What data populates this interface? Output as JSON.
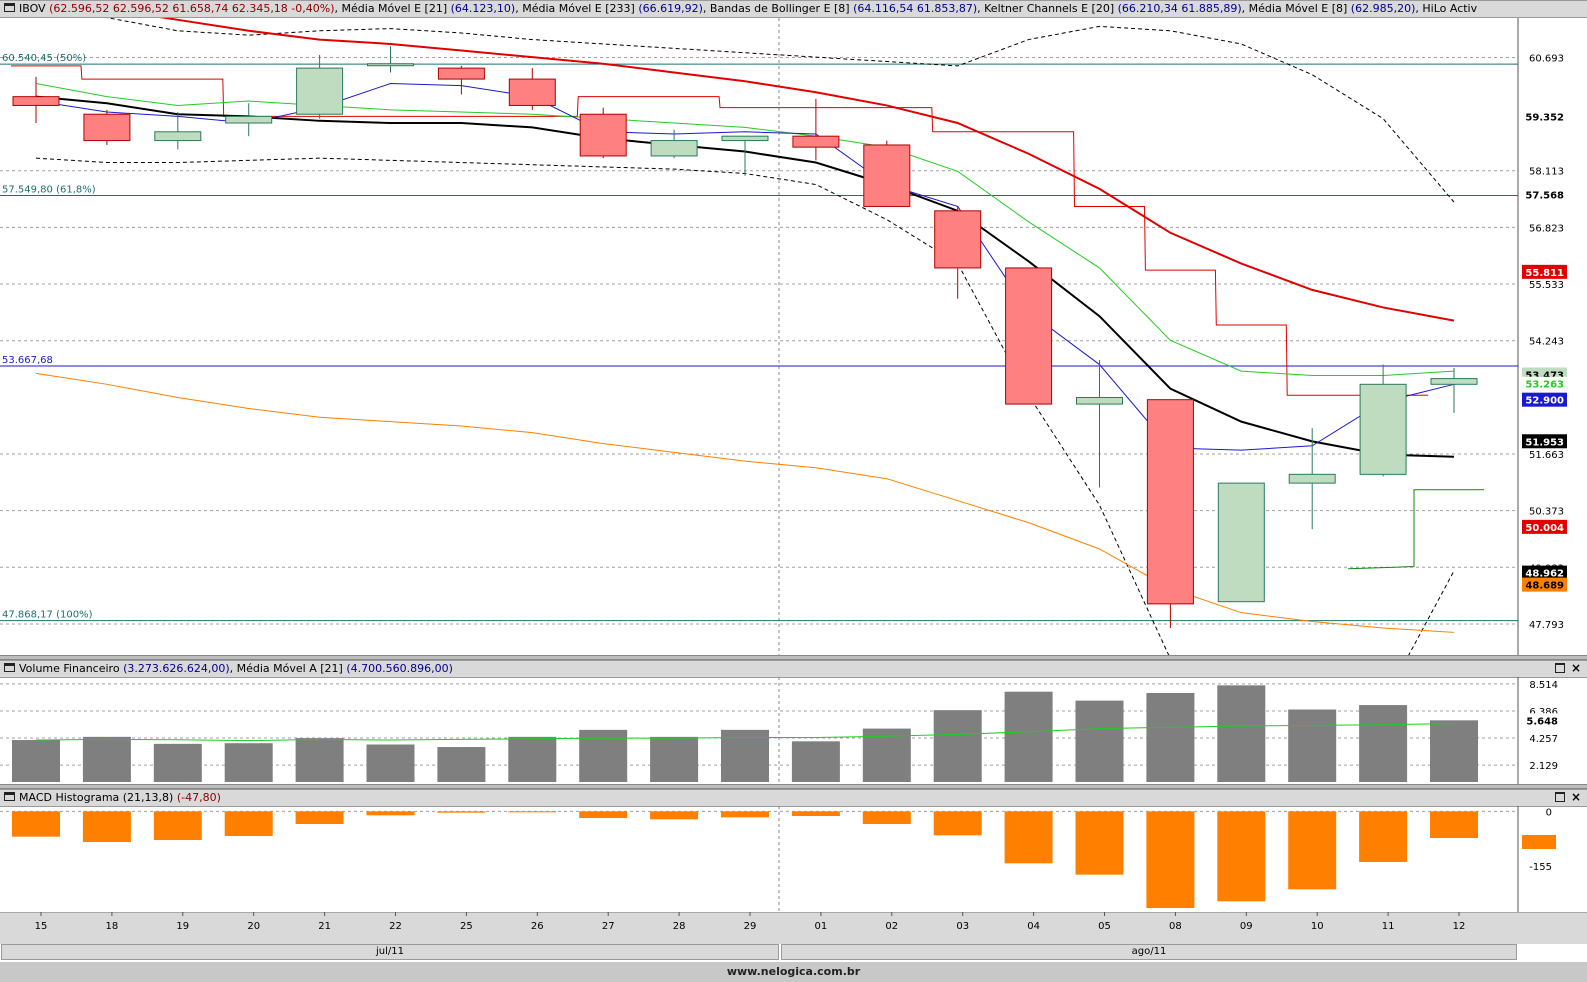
{
  "main_header": {
    "symbol": "IBOV",
    "ohlc": "(62.596,52  62.596,52  61.658,74  62.345,18  -0,40%)",
    "ema21_label": "Média Móvel E [21]",
    "ema21_val": "(64.123,10)",
    "ema233_label": "Média Móvel E [233]",
    "ema233_val": "(66.619,92)",
    "boll_label": "Bandas de Bollinger E [8]",
    "boll_val": "(64.116,54  61.853,87)",
    "kelt_label": "Keltner Channels E [20]",
    "kelt_val": "(66.210,34  61.885,89)",
    "ema8_label": "Média Móvel E [8]",
    "ema8_val": "(62.985,20)",
    "hilo_label": "HiLo Activ"
  },
  "vol_header": {
    "label": "Volume Financeiro",
    "val": "(3.273.626.624,00)",
    "ma_label": "Média Móvel A [21]",
    "ma_val": "(4.700.560.896,00)"
  },
  "macd_header": {
    "label": "MACD Histograma (21,13,8)",
    "val": "(-47,80)"
  },
  "footer": {
    "url": "www.nelogica.com.br"
  },
  "months": [
    "jul/11",
    "ago/11"
  ],
  "colors": {
    "bull_fill": "#c0dcc0",
    "bull_stroke": "#2a7a5a",
    "bear_fill": "#ff8080",
    "bear_stroke": "#b00000",
    "ema21": "#e00000",
    "ema233": "#ff8000",
    "ema8_green": "#22cc22",
    "black_line": "#000000",
    "blue_line": "#1a1acc",
    "hilo": "#e00000",
    "volume": "#7f7f7f",
    "macd": "#ff8000",
    "fibo": "#1f6f6f"
  },
  "chart_data": [
    {
      "type": "candlestick",
      "title": "IBOV",
      "categories": [
        "15",
        "18",
        "19",
        "20",
        "21",
        "22",
        "25",
        "26",
        "27",
        "28",
        "29",
        "01",
        "02",
        "03",
        "04",
        "05",
        "08",
        "09",
        "10",
        "11",
        "12"
      ],
      "ylim": [
        47200,
        61500
      ],
      "y_ticks": [
        60693,
        58113,
        56823,
        55533,
        54243,
        51663,
        50373,
        49083,
        47793
      ],
      "y_tick_labels": [
        "60.693",
        "58.113",
        "56.823",
        "55.533",
        "54.243",
        "51.663",
        "50.373",
        "49.083",
        "47.793"
      ],
      "ohlc": [
        [
          59800,
          60250,
          59200,
          59600
        ],
        [
          59400,
          59500,
          58700,
          58800
        ],
        [
          58800,
          59450,
          58600,
          59000
        ],
        [
          59200,
          59650,
          58900,
          59350
        ],
        [
          59400,
          60750,
          59300,
          60450
        ],
        [
          60550,
          60950,
          60350,
          60550
        ],
        [
          60450,
          60500,
          59850,
          60200
        ],
        [
          60200,
          60450,
          59500,
          59600
        ],
        [
          59400,
          59550,
          58400,
          58450
        ],
        [
          58450,
          59050,
          58400,
          58800
        ],
        [
          58800,
          58900,
          58000,
          58900
        ],
        [
          58900,
          59750,
          58350,
          58650
        ],
        [
          58700,
          58800,
          57300,
          57300
        ],
        [
          57200,
          57300,
          55200,
          55900
        ],
        [
          55900,
          55900,
          52800,
          52800
        ],
        [
          52800,
          53800,
          50900,
          52950
        ],
        [
          52900,
          52900,
          47700,
          48250
        ],
        [
          48300,
          51000,
          48300,
          51000
        ],
        [
          51000,
          52250,
          49950,
          51200
        ],
        [
          51200,
          53700,
          51150,
          53250
        ],
        [
          53250,
          53620,
          52600,
          53380
        ]
      ],
      "series": [
        {
          "name": "Média Móvel E [21]",
          "color": "#e00000",
          "values": [
            62000,
            61800,
            61550,
            61300,
            61100,
            61000,
            60850,
            60700,
            60550,
            60350,
            60150,
            59900,
            59600,
            59200,
            58500,
            57700,
            56700,
            56000,
            55400,
            55000,
            54700
          ]
        },
        {
          "name": "Média Móvel E [233]",
          "color": "#ff8000",
          "values": [
            53500,
            53250,
            52950,
            52700,
            52500,
            52400,
            52300,
            52150,
            51900,
            51700,
            51500,
            51350,
            51100,
            50600,
            50100,
            49500,
            48600,
            48050,
            47850,
            47700,
            47600
          ]
        },
        {
          "name": "Média Móvel E [8]",
          "color": "#22cc22",
          "values": [
            60100,
            59800,
            59600,
            59700,
            59600,
            59500,
            59450,
            59400,
            59300,
            59200,
            59100,
            58900,
            58650,
            58100,
            56950,
            55900,
            54250,
            53550,
            53450,
            53450,
            53550
          ]
        },
        {
          "name": "Keltner Channels E [20]",
          "color": "#000000",
          "values": [
            59800,
            59650,
            59400,
            59350,
            59250,
            59200,
            59200,
            59100,
            58850,
            58700,
            58550,
            58300,
            57800,
            57200,
            56050,
            54800,
            53150,
            52400,
            51950,
            51650,
            51600
          ]
        },
        {
          "name": "Bandas de Bollinger E [8]",
          "color": "#1a1acc",
          "values": [
            59700,
            59450,
            59350,
            59200,
            59550,
            60100,
            60050,
            59800,
            59000,
            58950,
            59000,
            58950,
            57800,
            57300,
            54900,
            53700,
            51800,
            51750,
            51850,
            52850,
            53250
          ]
        }
      ],
      "hilo_steps": [
        60500,
        60200,
        60200,
        59350,
        59350,
        59350,
        59350,
        59350,
        59800,
        59800,
        59550,
        59550,
        59550,
        59000,
        59000,
        57300,
        55850,
        54600,
        53000,
        53000
      ],
      "hilo_support": [
        49500,
        49500,
        49500,
        49500,
        49500,
        49500,
        49500,
        49500,
        49500,
        49500,
        49500,
        49500,
        49500,
        49500,
        49500,
        49500,
        49500,
        49500,
        49050,
        49100,
        50850
      ],
      "h_lines": [
        {
          "value": 60540,
          "label": "60.540,45 (50%)",
          "color": "#1f6f6f"
        },
        {
          "value": 57549,
          "label": "57.549,80 (61,8%)",
          "color": "#1f6f6f"
        },
        {
          "value": 53667,
          "label": "53.667,68",
          "color": "#1a1acc"
        },
        {
          "value": 47868,
          "label": "47.868,17 (100%)",
          "color": "#1f6f6f"
        }
      ],
      "last_labels": [
        {
          "value": 59352,
          "text": "59.352",
          "color": "#000000",
          "bg": "#ffffff"
        },
        {
          "value": 57568,
          "text": "57.568",
          "color": "#000000",
          "bg": "#ffffff"
        },
        {
          "value": 55811,
          "text": "55.811",
          "color": "#ffffff",
          "bg": "#e00000"
        },
        {
          "value": 53473,
          "text": "53.473",
          "color": "#000000",
          "bg": "#c0dcc0"
        },
        {
          "value": 53263,
          "text": "53.263",
          "color": "#22cc22",
          "bg": "#ffffff"
        },
        {
          "value": 52900,
          "text": "52.900",
          "color": "#ffffff",
          "bg": "#1a1acc"
        },
        {
          "value": 51953,
          "text": "51.953",
          "color": "#ffffff",
          "bg": "#000000"
        },
        {
          "value": 50004,
          "text": "50.004",
          "color": "#ffffff",
          "bg": "#e00000"
        },
        {
          "value": 48962,
          "text": "48.962",
          "color": "#ffffff",
          "bg": "#000000"
        },
        {
          "value": 48689,
          "text": "48.689",
          "color": "#000000",
          "bg": "#ff8000"
        }
      ]
    },
    {
      "type": "bar",
      "title": "Volume Financeiro",
      "categories": [
        "15",
        "18",
        "19",
        "20",
        "21",
        "22",
        "25",
        "26",
        "27",
        "28",
        "29",
        "01",
        "02",
        "03",
        "04",
        "05",
        "08",
        "09",
        "10",
        "11",
        "12"
      ],
      "values": [
        4.1,
        4.35,
        3.8,
        3.85,
        4.25,
        3.75,
        3.55,
        4.35,
        4.9,
        4.35,
        4.9,
        4.0,
        5.0,
        6.45,
        7.9,
        7.2,
        7.8,
        8.4,
        6.5,
        6.85,
        5.65
      ],
      "ma_values": [
        4.1,
        4.15,
        4.12,
        4.05,
        4.15,
        4.1,
        4.15,
        4.2,
        4.25,
        4.25,
        4.3,
        4.3,
        4.4,
        4.55,
        4.75,
        5.0,
        5.1,
        5.2,
        5.25,
        5.3,
        5.4
      ],
      "ylim": [
        0.8,
        8.9
      ],
      "y_ticks": [
        8.514,
        6.386,
        4.257,
        2.129
      ],
      "y_tick_labels": [
        "8.514",
        "6.386",
        "4.257",
        "2.129"
      ],
      "last_label": "5.648"
    },
    {
      "type": "bar",
      "title": "MACD Histograma (21,13,8)",
      "categories": [
        "15",
        "18",
        "19",
        "20",
        "21",
        "22",
        "25",
        "26",
        "27",
        "28",
        "29",
        "01",
        "02",
        "03",
        "04",
        "05",
        "08",
        "09",
        "10",
        "11",
        "12"
      ],
      "values": [
        -38,
        -46,
        -43,
        -37,
        -19,
        -6,
        -2,
        -1,
        -10,
        -12,
        -9,
        -7,
        -19,
        -36,
        -78,
        -95,
        -145,
        -135,
        -117,
        -76,
        -40
      ],
      "ylim": [
        -148,
        5
      ],
      "y_ticks": [
        0,
        -155
      ],
      "y_tick_labels": [
        "0",
        "-155"
      ]
    }
  ]
}
